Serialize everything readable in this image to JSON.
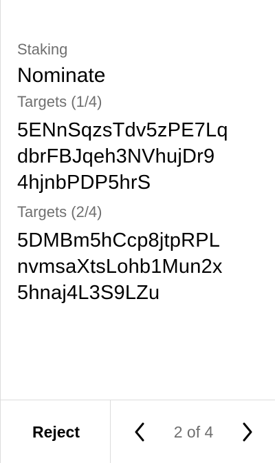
{
  "header": {
    "category": "Staking",
    "operation": "Nominate"
  },
  "fields": [
    {
      "label": "Targets (1/4)",
      "lines": [
        "5ENnSqzsTdv5zPE7Lq",
        "dbrFBJqeh3NVhujDr9",
        "4hjnbPDP5hrS"
      ]
    },
    {
      "label": "Targets (2/4)",
      "lines": [
        "5DMBm5hCcp8jtpRPL",
        "nvmsaXtsLohb1Mun2x",
        "5hnaj4L3S9LZu"
      ]
    }
  ],
  "footer": {
    "reject_label": "Reject",
    "page_indicator": "2 of 4",
    "prev_icon": "chevron-left-icon",
    "next_icon": "chevron-right-icon"
  },
  "colors": {
    "text": "#000000",
    "muted": "#6f6f6f",
    "divider": "#dcdcdc"
  }
}
